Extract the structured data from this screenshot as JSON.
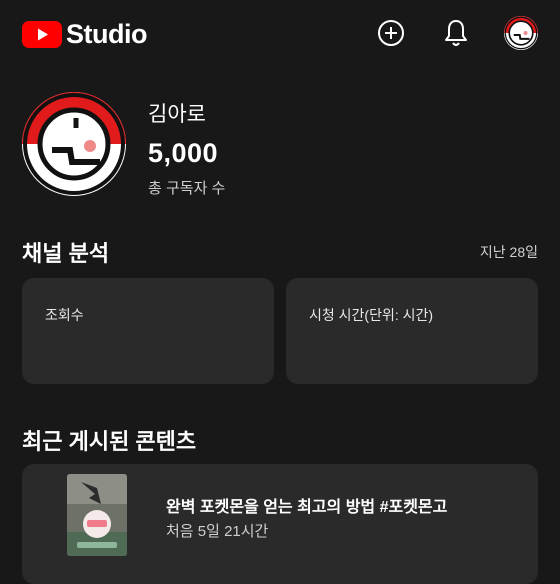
{
  "header": {
    "logo_text": "Studio",
    "create_icon": "add-circle-icon",
    "notifications_icon": "bell-icon",
    "account_icon": "avatar"
  },
  "channel": {
    "name": "김아로",
    "subscriber_count": "5,000",
    "subscriber_label": "총 구독자 수"
  },
  "analytics": {
    "title": "채널 분석",
    "period": "지난 28일",
    "cards": [
      {
        "label": "조회수"
      },
      {
        "label": "시청 시간(단위: 시간)"
      }
    ]
  },
  "recent": {
    "title": "최근 게시된 콘텐츠",
    "items": [
      {
        "title": "완벽 포켓몬을 얻는 최고의 방법 #포켓몬고",
        "meta": "처음 5일 21시간"
      }
    ]
  },
  "colors": {
    "background": "#181818",
    "card": "#2a2a2a",
    "brand_red": "#ff0000",
    "text_primary": "#ffffff",
    "text_secondary": "#cfcfcf"
  }
}
